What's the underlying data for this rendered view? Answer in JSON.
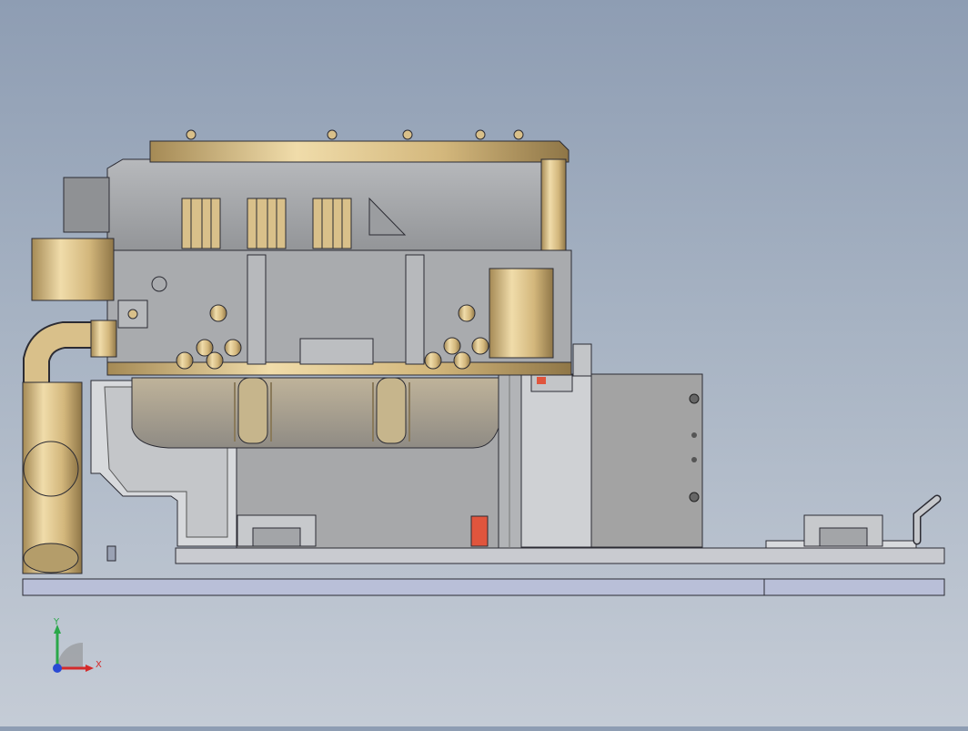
{
  "viewport": {
    "background_top": "#8e9db3",
    "background_bottom": "#c5ccd6",
    "model": {
      "housing_color": "#a3a5a8",
      "brass_color": "#d9c08a",
      "fixture_color": "#cfd1d4",
      "base_rail_color": "#b9bfd8",
      "accent_red": "#e0553d"
    }
  },
  "triad": {
    "x_label": "X",
    "y_label": "Y",
    "x_color": "#d42a2a",
    "y_color": "#2aa84a",
    "z_color": "#2a4ad4"
  }
}
